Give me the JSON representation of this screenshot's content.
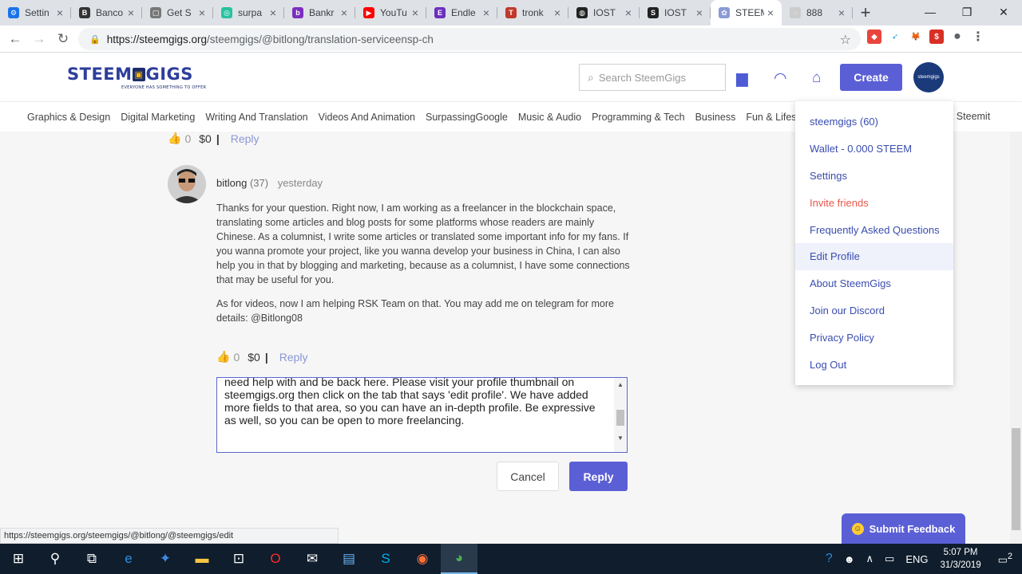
{
  "browser": {
    "tabs": [
      {
        "title": "Settin",
        "fav_color": "#1a73e8",
        "fav_glyph": "⚙"
      },
      {
        "title": "Banco",
        "fav_color": "#333333",
        "fav_glyph": "B"
      },
      {
        "title": "Get S",
        "fav_color": "#777777",
        "fav_glyph": "▢"
      },
      {
        "title": "surpa",
        "fav_color": "#27c2a0",
        "fav_glyph": "◎"
      },
      {
        "title": "Bankr",
        "fav_color": "#7b2fbf",
        "fav_glyph": "b"
      },
      {
        "title": "YouTu",
        "fav_color": "#ff0000",
        "fav_glyph": "▶"
      },
      {
        "title": "Endle",
        "fav_color": "#6c2fbf",
        "fav_glyph": "E"
      },
      {
        "title": "tronk",
        "fav_color": "#c0392b",
        "fav_glyph": "T"
      },
      {
        "title": "IOST",
        "fav_color": "#222222",
        "fav_glyph": "◍"
      },
      {
        "title": "IOST",
        "fav_color": "#222222",
        "fav_glyph": "S"
      },
      {
        "title": "STEEM",
        "fav_color": "#8a9bd6",
        "fav_glyph": "✿"
      },
      {
        "title": "888",
        "fav_color": "#cccccc",
        "fav_glyph": "◌"
      }
    ],
    "active_tab_index": 10,
    "url_host": "https://steemgigs.org",
    "url_path": "/steemgigs/@bitlong/translation-serviceensp-ch"
  },
  "site": {
    "logo_left": "STEEM",
    "logo_mid": "▣",
    "logo_right": "GIGS",
    "logo_tagline": "EVERYONE HAS SOMETHING TO OFFER",
    "search_placeholder": "Search SteemGigs",
    "create_label": "Create",
    "avatar_label": "steemgigs"
  },
  "categories": [
    "Graphics & Design",
    "Digital Marketing",
    "Writing And Translation",
    "Videos And Animation",
    "SurpassingGoogle",
    "Music & Audio",
    "Programming & Tech",
    "Business",
    "Fun & Lifesty"
  ],
  "category_last": "& Steemit",
  "top_votebar": {
    "count": "0",
    "amount": "$0",
    "sep": "|",
    "reply": "Reply"
  },
  "comment": {
    "author": "bitlong",
    "rep": "(37)",
    "time": "yesterday",
    "paragraphs": [
      "Thanks for your question. Right now, I am working as a freelancer in the blockchain space, translating some articles and blog posts for some platforms whose readers are mainly Chinese. As a columnist, I write some articles or translated some important info for my fans. If you wanna promote your project, like you wanna develop your business in China, I can also help you in that by blogging and marketing, because as a columnist, I have some connections that may be useful for you.",
      "As for videos, now I am helping RSK Team on that. You may add me on telegram for more details: @Bitlong08"
    ],
    "votebar": {
      "count": "0",
      "amount": "$0",
      "sep": "|",
      "reply": "Reply"
    }
  },
  "reply_form": {
    "text": "need help with and be back here. Please visit your profile thumbnail on steemgigs.org then click on the tab that says 'edit profile'. We have added more fields to that area, so you can have an in-depth profile. Be expressive as well, so you can be open to more freelancing.",
    "cancel_label": "Cancel",
    "reply_label": "Reply"
  },
  "dropdown": {
    "items": [
      "steemgigs (60)",
      "Wallet - 0.000 STEEM",
      "Settings",
      "Invite friends",
      "Frequently Asked Questions",
      "Edit Profile",
      "About SteemGigs",
      "Join our Discord",
      "Privacy Policy",
      "Log Out"
    ],
    "highlighted_index": 5,
    "invite_color": "#e8574a"
  },
  "status_url": "https://steemgigs.org/steemgigs/@bitlong/@steemgigs/edit",
  "feedback_label": "Submit Feedback",
  "taskbar": {
    "lang": "ENG",
    "time": "5:07 PM",
    "date": "31/3/2019",
    "notif_count": "2"
  },
  "colors": {
    "accent": "#5b5fd6",
    "link": "#3a4db0",
    "reply_link": "#8a97d6"
  }
}
